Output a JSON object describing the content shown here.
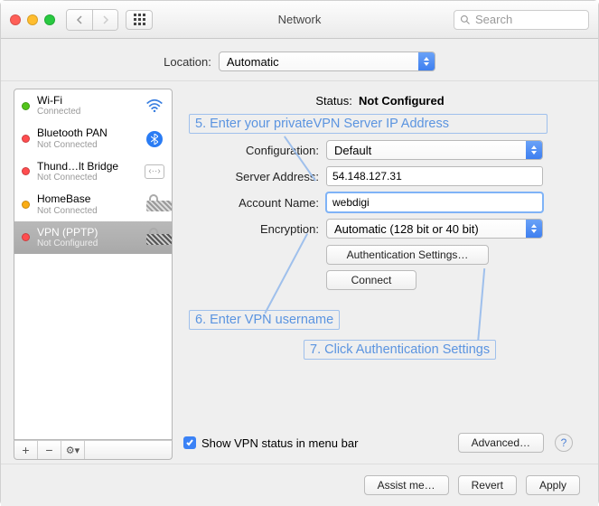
{
  "window": {
    "title": "Network"
  },
  "search": {
    "placeholder": "Search"
  },
  "location": {
    "label": "Location:",
    "value": "Automatic"
  },
  "sidebar": {
    "items": [
      {
        "name": "Wi-Fi",
        "sub": "Connected"
      },
      {
        "name": "Bluetooth PAN",
        "sub": "Not Connected"
      },
      {
        "name": "Thund…lt Bridge",
        "sub": "Not Connected"
      },
      {
        "name": "HomeBase",
        "sub": "Not Connected"
      },
      {
        "name": "VPN (PPTP)",
        "sub": "Not Configured"
      }
    ]
  },
  "detail": {
    "status_label": "Status:",
    "status_value": "Not Configured",
    "config_label": "Configuration:",
    "config_value": "Default",
    "server_label": "Server Address:",
    "server_value": "54.148.127.31",
    "account_label": "Account Name:",
    "account_value": "webdigi",
    "encryption_label": "Encryption:",
    "encryption_value": "Automatic (128 bit or 40 bit)",
    "auth_btn": "Authentication Settings…",
    "connect_btn": "Connect",
    "show_status": "Show VPN status in menu bar",
    "advanced_btn": "Advanced…"
  },
  "annotations": {
    "a5": "5. Enter your privateVPN Server IP Address",
    "a6": "6. Enter VPN username",
    "a7": "7. Click Authentication Settings"
  },
  "footer": {
    "assist": "Assist me…",
    "revert": "Revert",
    "apply": "Apply"
  },
  "toolbar": {
    "plus": "+",
    "minus": "−",
    "gear": "⚙︎▾"
  }
}
